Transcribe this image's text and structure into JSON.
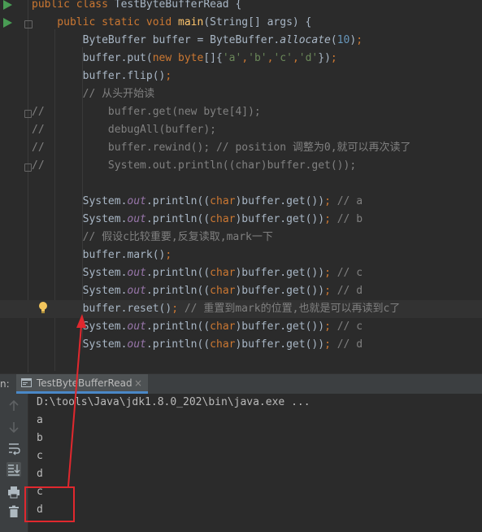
{
  "editor": {
    "lines": [
      {
        "parts": [
          {
            "t": "public class ",
            "c": "kw"
          },
          {
            "t": "TestByteBufferRead {",
            "c": ""
          }
        ]
      },
      {
        "parts": [
          {
            "t": "    public static void ",
            "c": "kw"
          },
          {
            "t": "main",
            "c": "fn"
          },
          {
            "t": "(String[] args) {",
            "c": ""
          }
        ]
      },
      {
        "parts": [
          {
            "t": "        ByteBuffer buffer = ByteBuffer.",
            "c": ""
          },
          {
            "t": "allocate",
            "c": "itm"
          },
          {
            "t": "(",
            "c": ""
          },
          {
            "t": "10",
            "c": "num"
          },
          {
            "t": ")",
            "c": ""
          },
          {
            "t": ";",
            "c": "kw"
          }
        ]
      },
      {
        "parts": [
          {
            "t": "        buffer.put(",
            "c": ""
          },
          {
            "t": "new byte",
            "c": "kw"
          },
          {
            "t": "[]{",
            "c": ""
          },
          {
            "t": "'a'",
            "c": "str"
          },
          {
            "t": ",",
            "c": "kw"
          },
          {
            "t": "'b'",
            "c": "str"
          },
          {
            "t": ",",
            "c": "kw"
          },
          {
            "t": "'c'",
            "c": "str"
          },
          {
            "t": ",",
            "c": "kw"
          },
          {
            "t": "'d'",
            "c": "str"
          },
          {
            "t": "})",
            "c": ""
          },
          {
            "t": ";",
            "c": "kw"
          }
        ]
      },
      {
        "parts": [
          {
            "t": "        buffer.flip()",
            "c": ""
          },
          {
            "t": ";",
            "c": "kw"
          }
        ]
      },
      {
        "parts": [
          {
            "t": "        // 从头开始读",
            "c": "cm"
          }
        ]
      },
      {
        "parts": [
          {
            "t": "//",
            "c": "cm"
          },
          {
            "t": "          buffer.get(new byte[4]);",
            "c": "cm"
          }
        ]
      },
      {
        "parts": [
          {
            "t": "//",
            "c": "cm"
          },
          {
            "t": "          debugAll(buffer);",
            "c": "cm"
          }
        ]
      },
      {
        "parts": [
          {
            "t": "//",
            "c": "cm"
          },
          {
            "t": "          buffer.rewind(); // position 调整为0,就可以再次读了",
            "c": "cm"
          }
        ]
      },
      {
        "parts": [
          {
            "t": "//",
            "c": "cm"
          },
          {
            "t": "          System.out.println((char)buffer.get());",
            "c": "cm"
          }
        ]
      },
      {
        "parts": [
          {
            "t": "",
            "c": ""
          }
        ]
      },
      {
        "parts": [
          {
            "t": "        System.",
            "c": ""
          },
          {
            "t": "out",
            "c": "it"
          },
          {
            "t": ".println((",
            "c": ""
          },
          {
            "t": "char",
            "c": "kw"
          },
          {
            "t": ")buffer.get())",
            "c": ""
          },
          {
            "t": ";",
            "c": "kw"
          },
          {
            "t": " // a",
            "c": "cm"
          }
        ]
      },
      {
        "parts": [
          {
            "t": "        System.",
            "c": ""
          },
          {
            "t": "out",
            "c": "it"
          },
          {
            "t": ".println((",
            "c": ""
          },
          {
            "t": "char",
            "c": "kw"
          },
          {
            "t": ")buffer.get())",
            "c": ""
          },
          {
            "t": ";",
            "c": "kw"
          },
          {
            "t": " // b",
            "c": "cm"
          }
        ]
      },
      {
        "parts": [
          {
            "t": "        // 假设c比较重要,反复读取,mark一下",
            "c": "cm"
          }
        ]
      },
      {
        "parts": [
          {
            "t": "        buffer.mark()",
            "c": ""
          },
          {
            "t": ";",
            "c": "kw"
          }
        ]
      },
      {
        "parts": [
          {
            "t": "        System.",
            "c": ""
          },
          {
            "t": "out",
            "c": "it"
          },
          {
            "t": ".println((",
            "c": ""
          },
          {
            "t": "char",
            "c": "kw"
          },
          {
            "t": ")buffer.get())",
            "c": ""
          },
          {
            "t": ";",
            "c": "kw"
          },
          {
            "t": " // c",
            "c": "cm"
          }
        ]
      },
      {
        "parts": [
          {
            "t": "        System.",
            "c": ""
          },
          {
            "t": "out",
            "c": "it"
          },
          {
            "t": ".println((",
            "c": ""
          },
          {
            "t": "char",
            "c": "kw"
          },
          {
            "t": ")buffer.get())",
            "c": ""
          },
          {
            "t": ";",
            "c": "kw"
          },
          {
            "t": " // d",
            "c": "cm"
          }
        ]
      },
      {
        "parts": [
          {
            "t": "        buffer.reset()",
            "c": ""
          },
          {
            "t": ";",
            "c": "kw"
          },
          {
            "t": " // 重置到mark的位置,也就是可以再读到c了",
            "c": "cm"
          }
        ]
      },
      {
        "parts": [
          {
            "t": "        System.",
            "c": ""
          },
          {
            "t": "out",
            "c": "it"
          },
          {
            "t": ".println((",
            "c": ""
          },
          {
            "t": "char",
            "c": "kw"
          },
          {
            "t": ")buffer.get())",
            "c": ""
          },
          {
            "t": ";",
            "c": "kw"
          },
          {
            "t": " // c",
            "c": "cm"
          }
        ]
      },
      {
        "parts": [
          {
            "t": "        System.",
            "c": ""
          },
          {
            "t": "out",
            "c": "it"
          },
          {
            "t": ".println((",
            "c": ""
          },
          {
            "t": "char",
            "c": "kw"
          },
          {
            "t": ")buffer.get())",
            "c": ""
          },
          {
            "t": ";",
            "c": "kw"
          },
          {
            "t": " // d",
            "c": "cm"
          }
        ]
      }
    ]
  },
  "run": {
    "label": "n:",
    "tab_title": "TestByteBufferRead",
    "tab_close": "×",
    "output": [
      "D:\\tools\\Java\\jdk1.8.0_202\\bin\\java.exe ...",
      "a",
      "b",
      "c",
      "d",
      "c",
      "d"
    ]
  },
  "colors": {
    "keyword": "#cc7832",
    "method": "#ffc66d",
    "number": "#6897bb",
    "string": "#6a8759",
    "static_field": "#9876aa",
    "comment": "#808080",
    "annotation": "#e0282e"
  }
}
